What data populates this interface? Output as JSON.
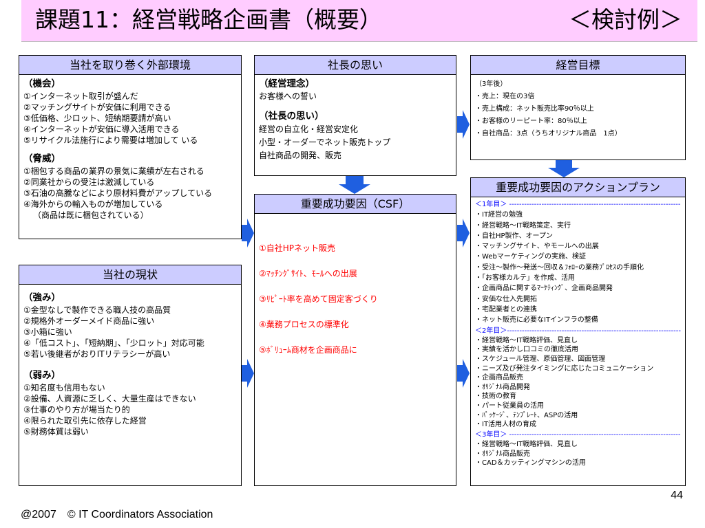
{
  "title": {
    "main": "課題11：経営戦略企画書（概要）",
    "right": "＜検討例＞"
  },
  "env": {
    "header": "当社を取り巻く外部環境",
    "opportunity_title": "（機会）",
    "opportunities": [
      "①インターネット取引が盛んだ",
      "②マッチングサイトが安価に利用できる",
      "③低価格、少ロット、短納期要請が高い",
      "④インターネットが安価に導入活用できる",
      "⑤リサイクル法施行により需要は増加して いる"
    ],
    "threat_title": "（脅威）",
    "threats": [
      "①梱包する商品の業界の景気に業績が左右される",
      "②同業社からの受注は激減している",
      "③石油の高騰などにより原材料費がアップしている",
      "④海外からの輸入ものが増加している",
      "（商品は既に梱包されている）"
    ]
  },
  "current": {
    "header": "当社の現状",
    "strength_title": "（強み）",
    "strengths": [
      "①金型なしで製作できる職人技の高品質",
      "②規格外オーダーメイド商品に強い",
      "③小箱に強い",
      "④「低コスト」、「短納期」、「少ロット」対応可能",
      "⑤若い後継者がおりITリテラシーが高い"
    ],
    "weakness_title": "（弱み）",
    "weaknesses": [
      "①知名度も信用もない",
      "②設備、人資源に乏しく、大量生産はできない",
      "③仕事のやり方が場当たり的",
      "④限られた取引先に依存した経営",
      "⑤財務体質は弱い"
    ]
  },
  "president": {
    "header": "社長の思い",
    "philosophy_title": "（経営理念）",
    "philosophy": "お客様への誓い",
    "thoughts_title": "（社長の思い）",
    "thoughts": [
      "経営の自立化・経営安定化",
      "小型・オーダーでネット販売トップ",
      "自社商品の開発、販売"
    ]
  },
  "goals": {
    "header": "経営目標",
    "items": [
      "（3年後）",
      "・売上：現在の3倍",
      "・売上構成：ネット販売比率90％以上",
      "・お客様のリーピート率：80％以上",
      "・自社商品：3点（うちオリジナル商品　1点）"
    ]
  },
  "csf": {
    "header": "重要成功要因（CSF）",
    "items": [
      "①自社HPネット販売",
      "②ﾏｯﾁﾝｸﾞｻｲﾄ、ﾓｰﾙへの出展",
      "③ﾘﾋﾟｰﾄ率を高めて固定客づくり",
      "④業務プロセスの標準化",
      "⑤ﾎﾞﾘｭｰﾑ商材を企画商品に"
    ]
  },
  "action_plan": {
    "header": "重要成功要因のアクションプラン",
    "year1_label": "＜1年目＞ ------------------------------------------------------------------------",
    "year1": [
      "・IT経営の勉強",
      "・経営戦略～IT戦略策定、実行",
      "・自社HP製作、オープン",
      "・マッチングサイト、やモールへの出展",
      "・Webマーケティングの実施、検証",
      "・受注～製作～発送～回収＆ﾌｫﾛｰの業務ﾌﾟﾛｾｽの手順化",
      "・「お客様カルテ」を作成、活用",
      "・企画商品に関するﾏｰｹﾃｨﾝｸﾞ、企画商品開発",
      "・安価な仕入先開拓",
      "・宅配業者との連携",
      "・ネット販売に必要なITインフラの整備"
    ],
    "year2_label": "＜2年目＞--------------------------------------------------------------------------",
    "year2": [
      "・経営戦略～IT戦略評価、見直し",
      "・実績を活かし口コミの徹底活用",
      "・スケジュール管理、原価管理、図面管理",
      "・ニーズ及び発注タイミングに応じたコミュニケーション",
      "・企画商品販売",
      "・ｵﾘｼﾞﾅﾙ商品開発",
      "・技術の教育",
      "・パート従業員の活用",
      "・ﾊﾟｯｹｰｼﾞ、ﾃﾝﾌﾟﾚｰﾄ、ASPの活用",
      "・IT活用人材の育成"
    ],
    "year3_label": "＜3年目＞ ------------------------------------------------------------------------",
    "year3": [
      "・経営戦略～IT戦略評価、見直し",
      "・ｵﾘｼﾞﾅﾙ商品販売",
      "・CAD＆カッティングマシンの活用"
    ]
  },
  "footer": {
    "copyright": "@2007　© IT Coordinators Association",
    "page": "44"
  },
  "colors": {
    "title_bg": "#ffccff",
    "header_bg": "#ccccff",
    "arrow": "#1f5fe0",
    "highlight": "#ff0000",
    "year_label": "#0000ff"
  }
}
